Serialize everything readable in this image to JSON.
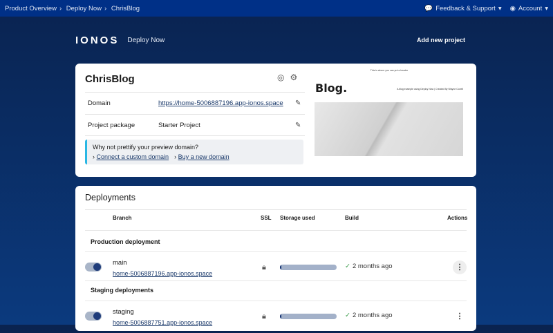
{
  "topbar": {
    "breadcrumbs": [
      "Product Overview",
      "Deploy Now",
      "ChrisBlog"
    ],
    "feedback": "Feedback & Support",
    "account": "Account"
  },
  "header": {
    "logo": "IONOS",
    "product": "Deploy Now",
    "add_project": "Add new project"
  },
  "project": {
    "name": "ChrisBlog",
    "domain_label": "Domain",
    "domain": "https://home-5006887196.app-ionos.space",
    "package_label": "Project package",
    "package": "Starter Project",
    "tip": "Why not prettify your preview domain?",
    "connect": "Connect a custom domain",
    "buy": "Buy a new domain",
    "preview": {
      "header_text": "This is where you can put a header",
      "title": "Blog.",
      "subtitle": "A blog example using Deploy Now | Created By Wayne Covell"
    }
  },
  "deployments": {
    "title": "Deployments",
    "columns": [
      "Branch",
      "SSL",
      "Storage used",
      "Build",
      "Actions"
    ],
    "production_label": "Production deployment",
    "staging_label": "Staging deployments",
    "rows": [
      {
        "branch": "main",
        "url": "home-5006887196.app-ionos.space",
        "storage_pct": 3,
        "build": "2 months ago"
      },
      {
        "branch": "staging",
        "url": "home-5006887751.app-ionos.space",
        "storage_pct": 3,
        "build": "2 months ago"
      }
    ]
  }
}
